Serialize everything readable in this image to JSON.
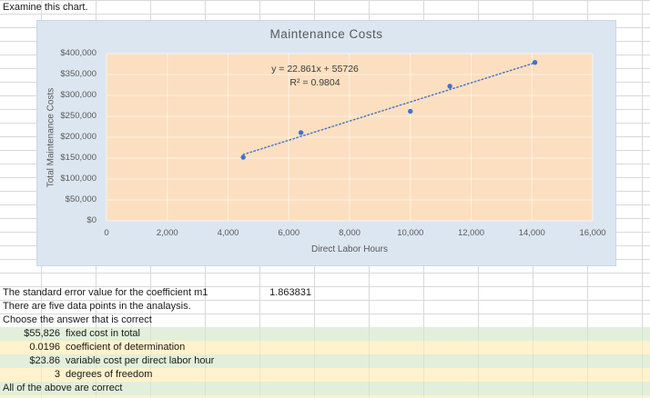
{
  "sheet": {
    "note": "Examine this chart.",
    "standard_error": {
      "label": "The standard error value for the coefficient m1",
      "value": "1.863831"
    },
    "five_points_note": "There are five data points in the analaysis.",
    "choose_prompt": "Choose the answer that is correct",
    "answers": [
      {
        "value": "$55,826",
        "label": "fixed cost in total"
      },
      {
        "value": "0.0196",
        "label": "coefficient of determination"
      },
      {
        "value": "$23.86",
        "label": "variable cost per direct labor hour"
      },
      {
        "value": "3",
        "label": "degrees of freedom"
      }
    ],
    "all_above": "All of the above are correct"
  },
  "chart_data": {
    "type": "scatter",
    "title": "Maintenance Costs",
    "xlabel": "Direct Labor Hours",
    "ylabel": "Total Maintenance Costs",
    "xlim": [
      0,
      16000
    ],
    "ylim": [
      0,
      400000
    ],
    "x_tick_values": [
      0,
      2000,
      4000,
      6000,
      8000,
      10000,
      12000,
      14000,
      16000
    ],
    "x_tick_labels": [
      "0",
      "2,000",
      "4,000",
      "6,000",
      "8,000",
      "10,000",
      "12,000",
      "14,000",
      "16,000"
    ],
    "y_tick_values": [
      0,
      50000,
      100000,
      150000,
      200000,
      250000,
      300000,
      350000,
      400000
    ],
    "y_tick_labels": [
      "$0",
      "$50,000",
      "$100,000",
      "$150,000",
      "$200,000",
      "$250,000",
      "$300,000",
      "$350,000",
      "$400,000"
    ],
    "points": [
      [
        4500,
        152000
      ],
      [
        6400,
        211000
      ],
      [
        10000,
        262000
      ],
      [
        11300,
        322000
      ],
      [
        14100,
        379000
      ]
    ],
    "trendline": {
      "slope": 22.861,
      "intercept": 55726,
      "x_start": 4500,
      "x_end": 14100,
      "equation": "y = 22.861x + 55726",
      "r_squared": "R² = 0.9804",
      "style": "dotted"
    },
    "grid": true,
    "legend": "none"
  },
  "colors": {
    "chart_bg": "#dce6f1",
    "plot_bg": "#fbdfc0",
    "plot_grid": "rgba(255,255,255,0.55)",
    "point": "#4472c4",
    "trend": "#4472c4",
    "green_row": "#e2efda",
    "yellow_row": "#fff2cc",
    "sheet_grid": "#d9d9d9",
    "axis_text": "#595959"
  }
}
